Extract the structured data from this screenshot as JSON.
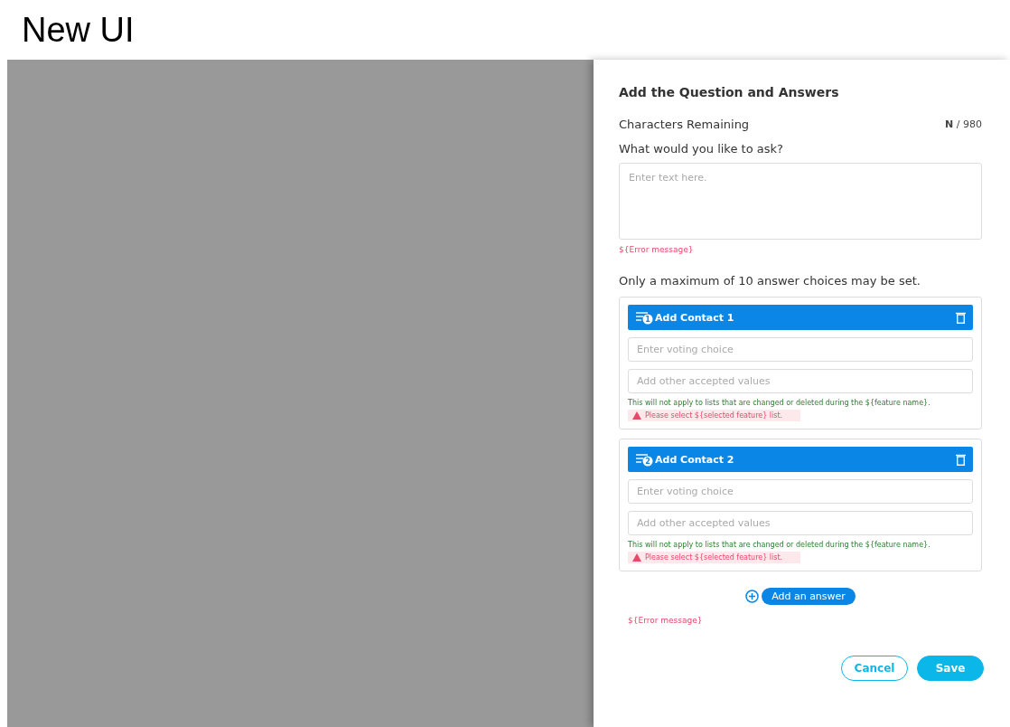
{
  "page_title": "New UI",
  "panel": {
    "title": "Add the Question and Answers",
    "chars_label": "Characters Remaining",
    "chars_count": "**N** / 980",
    "question_label": "What would you like to ask?",
    "question_placeholder": "Enter text here.",
    "question_error": "${Error message}",
    "max_note": "Only a maximum of 10 answer choices may be set.",
    "answers": [
      {
        "badge": "1",
        "title": "Add Contact 1",
        "choice_placeholder": "Enter voting choice",
        "values_placeholder": "Add other accepted values",
        "hint": "This will not apply to lists that are changed or deleted during the ${feature name}.",
        "warning": "Please select ${selected feature} list."
      },
      {
        "badge": "2",
        "title": "Add Contact 2",
        "choice_placeholder": "Enter voting choice",
        "values_placeholder": "Add other accepted values",
        "hint": "This will not apply to lists that are changed or deleted during the ${feature name}.",
        "warning": "Please select ${selected feature} list."
      }
    ],
    "add_answer": "Add an answer",
    "answers_error": "${Error message}",
    "buttons": {
      "cancel": "Cancel",
      "save": "Save"
    }
  }
}
